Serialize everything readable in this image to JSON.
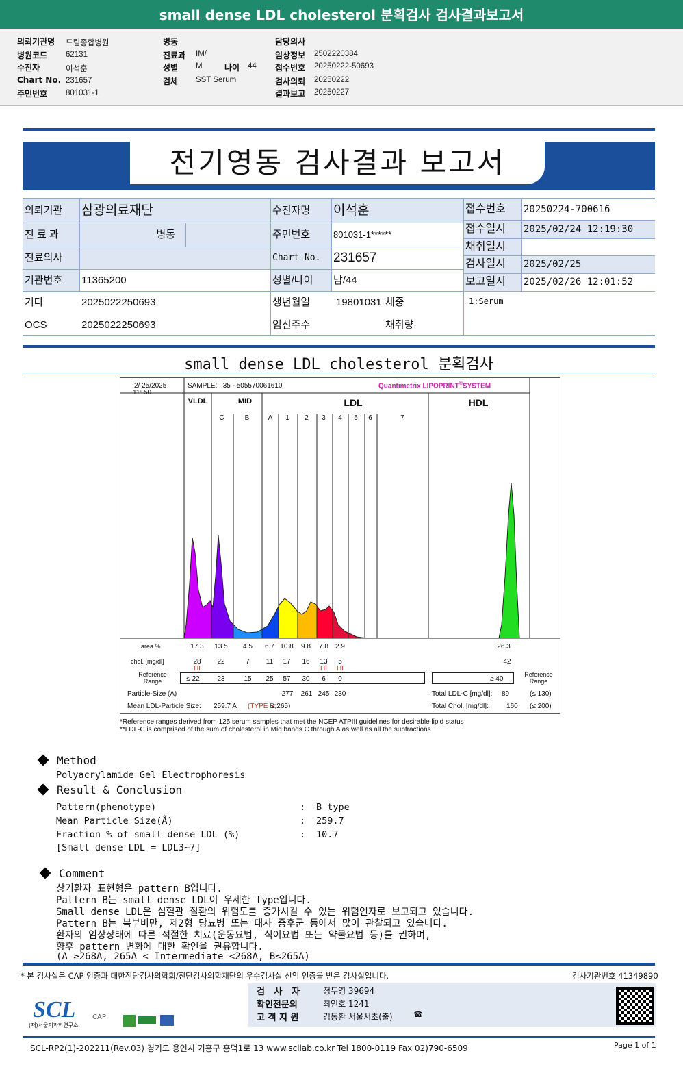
{
  "header": {
    "title": "small dense LDL cholesterol 분획검사 검사결과보고서"
  },
  "patient_info": {
    "col1": [
      {
        "label": "의뢰기관명",
        "value": "드림종합병원"
      },
      {
        "label": "병원코드",
        "value": "62131"
      },
      {
        "label": "수진자",
        "value": "이석훈"
      },
      {
        "label": "Chart No.",
        "value": "231657"
      },
      {
        "label": "주민번호",
        "value": "801031-1"
      }
    ],
    "col2": [
      {
        "label": "병동",
        "value": ""
      },
      {
        "label": "진료과",
        "value": "IM/"
      },
      {
        "label": "성별",
        "value": "M"
      },
      {
        "label": "검체",
        "value": "SST Serum"
      }
    ],
    "age_label": "나이",
    "age_value": "44",
    "col3": [
      {
        "label": "담당의사",
        "value": ""
      },
      {
        "label": "임상정보",
        "value": "2502220384"
      },
      {
        "label": "접수번호",
        "value": "20250222-50693"
      },
      {
        "label": "검사의뢰",
        "value": "20250222"
      },
      {
        "label": "결과보고",
        "value": "20250227"
      }
    ]
  },
  "report": {
    "title": "전기영동 검사결과 보고서"
  },
  "info_table": {
    "org_label": "의뢰기관",
    "org_value": "삼광의료재단",
    "dept_label": "진 료 과",
    "ward_label": "병동",
    "doctor_label": "진료의사",
    "inst_label": "기관번호",
    "inst_value": "11365200",
    "etc_label": "기타",
    "etc_value": "2025022250693",
    "ocs_label": "OCS",
    "ocs_value": "2025022250693",
    "name_label": "수진자명",
    "name_value": "이석훈",
    "rrn_label": "주민번호",
    "rrn_value": "801031-1******",
    "chart_label": "Chart No.",
    "chart_value": "231657",
    "sexage_label": "성별/나이",
    "sexage_value": "남/44",
    "dob_label": "생년월일",
    "dob_value": "19801031",
    "weight_label": "체중",
    "preg_label": "임신주수",
    "volume_label": "채취량",
    "recv_no_label": "접수번호",
    "recv_no_value": "20250224-700616",
    "recv_dt_label": "접수일시",
    "recv_dt_value": "2025/02/24 12:19:30",
    "collect_label": "채취일시",
    "test_dt_label": "검사일시",
    "test_dt_value": "2025/02/25",
    "report_dt_label": "보고일시",
    "report_dt_value": "2025/02/26 12:01:52",
    "specimen": "1:Serum"
  },
  "section_title": "small dense LDL cholesterol 분획검사",
  "lipoprint": {
    "date": "2/ 25/2025",
    "time": "11: 50",
    "sample_label": "SAMPLE:",
    "sample_value": "35 - 505570061610",
    "brand": "Quantimetrix LIPOPRINT",
    "brand_suffix": "SYSTEM",
    "groups": [
      "VLDL",
      "MID",
      "LDL",
      "HDL"
    ],
    "bands": [
      "C",
      "B",
      "A",
      "1",
      "2",
      "3",
      "4",
      "5",
      "6",
      "7"
    ],
    "colors": {
      "vldl": "#cc00ff",
      "c": "#7a00f0",
      "b": "#1e8fff",
      "a": "#0a46f0",
      "l1": "#ffff00",
      "l2": "#ffbb00",
      "l3": "#ff0033",
      "l4": "#e0103a",
      "hdl": "#22dd22"
    },
    "row_labels": {
      "area": "area %",
      "chol": "chol. [mg/dl]",
      "ref": "Reference Range",
      "size": "Particle-Size (A)",
      "mean": "Mean LDL-Particle Size:"
    },
    "area": [
      "17.3",
      "13.5",
      "4.5",
      "6.7",
      "10.8",
      "9.8",
      "7.8",
      "2.9"
    ],
    "hdl_area": "26.3",
    "chol": [
      "28",
      "22",
      "7",
      "11",
      "17",
      "16",
      "13",
      "5"
    ],
    "hdl_chol": "42",
    "flags": [
      "HI",
      "",
      "",
      "",
      "",
      "",
      "HI",
      "HI"
    ],
    "ref": [
      "≤ 22",
      "23",
      "15",
      "25",
      "57",
      "30",
      "6",
      "0"
    ],
    "hdl_ref": "≥  40",
    "sizes": [
      "277",
      "261",
      "245",
      "230"
    ],
    "mean_value": "259.7 A",
    "mean_type": "(TYPE B;",
    "mean_rest": "≤ 265)",
    "total_ldl_label": "Total LDL-C [mg/dl]:",
    "total_ldl": "89",
    "total_ldl_ref": "(≤ 130)",
    "total_chol_label": "Total Chol. [mg/dl]:",
    "total_chol": "160",
    "total_chol_ref": "(≤ 200)",
    "hdl_ref_label": "Reference Range"
  },
  "footnotes": [
    "*Reference ranges derived from 125 serum samples that met the NCEP ATPIII guidelines for desirable lipid status",
    "**LDL-C is comprised of the sum of cholesterol in Mid bands C through A as well as all the subfractions"
  ],
  "method": {
    "title": "Method",
    "text": "Polyacrylamide Gel Electrophoresis"
  },
  "result": {
    "title": "Result & Conclusion",
    "rows": [
      {
        "k": "Pattern(phenotype)",
        "v": "B type"
      },
      {
        "k": "Mean Particle Size(Å)",
        "v": "259.7"
      },
      {
        "k": "Fraction % of small dense LDL (%)",
        "v": "10.7"
      }
    ],
    "note": "[Small dense LDL = LDL3~7]"
  },
  "comment": {
    "title": "Comment",
    "lines": [
      "상기환자 표현형은 pattern B입니다.",
      "Pattern B는 small dense LDL이 우세한 type입니다.",
      "Small dense LDL은 심혈관 질환의 위험도를 증가시킬 수 있는 위험인자로 보고되고 있습니다.",
      "Pattern B는 복부비만, 제2형 당뇨병 또는 대사 증후군 등에서 많이 관찰되고 있습니다.",
      "환자의 임상상태에 따른 적절한 치료(운동요법, 식이요법 또는 약물요법 등)를 권하며,",
      "향후 pattern 변화에 대한 확인을 권유합니다.",
      "(A ≥268A, 265A < Intermediate <268A, B≤265A)"
    ]
  },
  "footer": {
    "cert": "* 본 검사실은 CAP 인증과 대한진단검사의학회/진단검사의학재단의 우수검사실 신임 인증을 받은 검사실입니다.",
    "lab_no": "검사기관번호 41349890",
    "staff": [
      {
        "role": "검   사   자",
        "name": "정두영 39694"
      },
      {
        "role": "확인전문의",
        "name": "최인호 1241"
      },
      {
        "role": "고 객 지 원",
        "name": "김동환 서울서초(출)"
      }
    ],
    "logo": "SCL",
    "logo_sub": "(재)서울의과학연구소",
    "cap": "CAP",
    "address": "SCL-RP2(1)-202211(Rev.03) 경기도 용인시 기흥구 흥덕1로 13  www.scllab.co.kr  Tel 1800-0119  Fax 02)790-6509",
    "page": "Page 1 of 1"
  }
}
